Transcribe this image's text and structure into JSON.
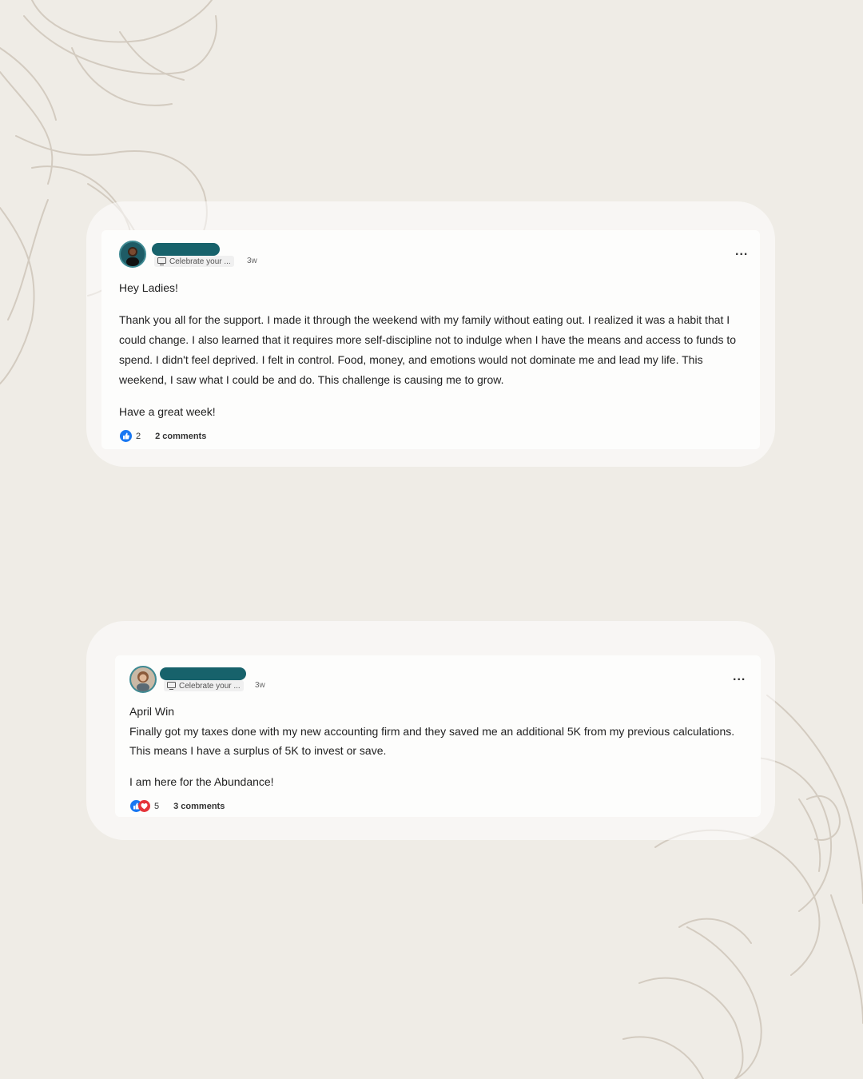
{
  "theme": {
    "background": "#efece6",
    "redaction": "#17626b",
    "like_blue": "#1877f2",
    "love_red": "#e5343a"
  },
  "posts": [
    {
      "category": "Celebrate your ...",
      "time": "3w",
      "more_label": "...",
      "paragraphs": [
        "Hey Ladies!",
        "Thank you all for the support. I made it through the weekend with my family without eating out. I realized it was a habit that I could change. I also learned that it requires more self-discipline not to indulge when I have the means and access to funds to spend. I didn't feel deprived. I felt in control. Food, money, and emotions would not dominate me and lead my life. This weekend, I saw what I could be and do. This challenge is causing me to grow.",
        "Have a great week!"
      ],
      "reactions": [
        "like-icon"
      ],
      "reaction_count": "2",
      "comments": "2 comments"
    },
    {
      "category": "Celebrate your ...",
      "time": "3w",
      "more_label": "...",
      "paragraphs": [
        "April Win",
        "Finally got my taxes done with my new accounting firm and they saved me an additional 5K from my previous calculations. This means I have a surplus of 5K to invest or save.",
        "I am here for the Abundance!"
      ],
      "reactions": [
        "like-icon",
        "love-icon"
      ],
      "reaction_count": "5",
      "comments": "3 comments"
    }
  ]
}
